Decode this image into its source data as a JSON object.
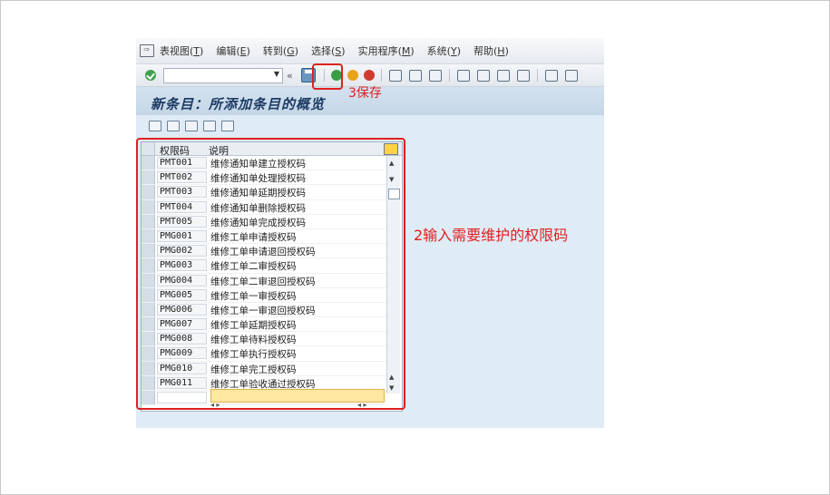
{
  "menu": {
    "items": [
      {
        "label": "表视图",
        "key": "T"
      },
      {
        "label": "编辑",
        "key": "E"
      },
      {
        "label": "转到",
        "key": "G"
      },
      {
        "label": "选择",
        "key": "S"
      },
      {
        "label": "实用程序",
        "key": "M"
      },
      {
        "label": "系统",
        "key": "Y"
      },
      {
        "label": "帮助",
        "key": "H"
      }
    ]
  },
  "toolbar": {
    "back_label": "«"
  },
  "page": {
    "title": "新条目：所添加条目的概览"
  },
  "table": {
    "columns": [
      "权限码",
      "说明"
    ],
    "rows": [
      {
        "code": "PMT001",
        "desc": "维修通知单建立授权码"
      },
      {
        "code": "PMT002",
        "desc": "维修通知单处理授权码"
      },
      {
        "code": "PMT003",
        "desc": "维修通知单延期授权码"
      },
      {
        "code": "PMT004",
        "desc": "维修通知单删除授权码"
      },
      {
        "code": "PMT005",
        "desc": "维修通知单完成授权码"
      },
      {
        "code": "PMG001",
        "desc": "维修工单申请授权码"
      },
      {
        "code": "PMG002",
        "desc": "维修工单申请退回授权码"
      },
      {
        "code": "PMG003",
        "desc": "维修工单二审授权码"
      },
      {
        "code": "PMG004",
        "desc": "维修工单二审退回授权码"
      },
      {
        "code": "PMG005",
        "desc": "维修工单一审授权码"
      },
      {
        "code": "PMG006",
        "desc": "维修工单一审退回授权码"
      },
      {
        "code": "PMG007",
        "desc": "维修工单延期授权码"
      },
      {
        "code": "PMG008",
        "desc": "维修工单待料授权码"
      },
      {
        "code": "PMG009",
        "desc": "维修工单执行授权码"
      },
      {
        "code": "PMG010",
        "desc": "维修工单完工授权码"
      },
      {
        "code": "PMG011",
        "desc": "维修工单验收通过授权码"
      }
    ]
  },
  "annotations": {
    "save_note": "3保存",
    "input_note": "2输入需要维护的权限码"
  }
}
